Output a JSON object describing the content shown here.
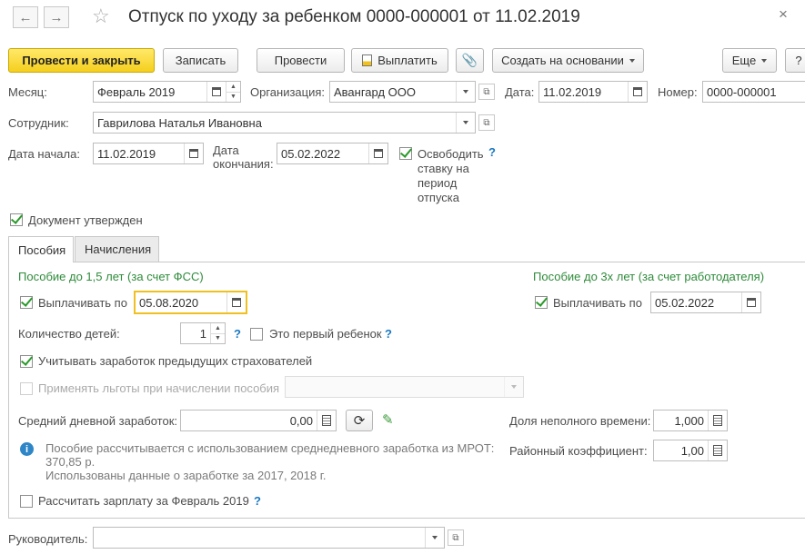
{
  "window": {
    "title": "Отпуск по уходу за ребенком 0000-000001 от 11.02.2019",
    "close_icon": "×"
  },
  "toolbar": {
    "post_close": "Провести и закрыть",
    "save": "Записать",
    "post": "Провести",
    "pay": "Выплатить",
    "create_based": "Создать на основании",
    "more": "Еще"
  },
  "header": {
    "month_label": "Месяц:",
    "month_value": "Февраль 2019",
    "org_label": "Организация:",
    "org_value": "Авангард ООО",
    "date_label": "Дата:",
    "date_value": "11.02.2019",
    "number_label": "Номер:",
    "number_value": "0000-000001",
    "employee_label": "Сотрудник:",
    "employee_value": "Гаврилова Наталья Ивановна",
    "start_label": "Дата начала:",
    "start_value": "11.02.2019",
    "end_label_1": "Дата",
    "end_label_2": "окончания:",
    "end_value": "05.02.2022",
    "free_rate_lines": [
      "Освободить",
      "ставку на",
      "период",
      "отпуска"
    ],
    "free_rate_checked": true,
    "approved_label": "Документ утвержден",
    "approved_checked": true
  },
  "tabs": [
    "Пособия",
    "Начисления"
  ],
  "benefits": {
    "left_title": "Пособие до 1,5 лет (за счет ФСС)",
    "right_title": "Пособие до 3х лет (за счет работодателя)",
    "pay_until_label": "Выплачивать по",
    "pay_until_value": "05.08.2020",
    "pay_until_checked": true,
    "pay_until3_label": "Выплачивать по",
    "pay_until3_value": "05.02.2022",
    "pay_until3_checked": true,
    "children_label": "Количество детей:",
    "children_value": "1",
    "first_child_label": "Это первый ребенок",
    "first_child_checked": false,
    "prev_insurers_label": "Учитывать заработок предыдущих страхователей",
    "prev_insurers_checked": true,
    "privileges_label": "Применять льготы при начислении пособия",
    "privileges_checked": false,
    "avg_earnings_label": "Средний дневной заработок:",
    "avg_earnings_value": "0,00",
    "part_time_label": "Доля неполного времени:",
    "part_time_value": "1,000",
    "regional_label": "Районный коэффициент:",
    "regional_value": "1,00",
    "info_lines": [
      "Пособие рассчитывается с использованием среднедневного заработка из МРОТ:",
      "370,85 р.",
      "Использованы данные о заработке за  2017,  2018 г."
    ],
    "calc_salary_label": "Рассчитать зарплату за Февраль 2019",
    "calc_salary_checked": false
  },
  "footer": {
    "manager_label": "Руководитель:",
    "manager_value": ""
  },
  "help_mark": "?",
  "colors": {
    "accent_yellow": "#f5cf1d",
    "section_green": "#2e8b3a",
    "help_blue": "#1a78c2",
    "focus_border": "#f0c020"
  }
}
